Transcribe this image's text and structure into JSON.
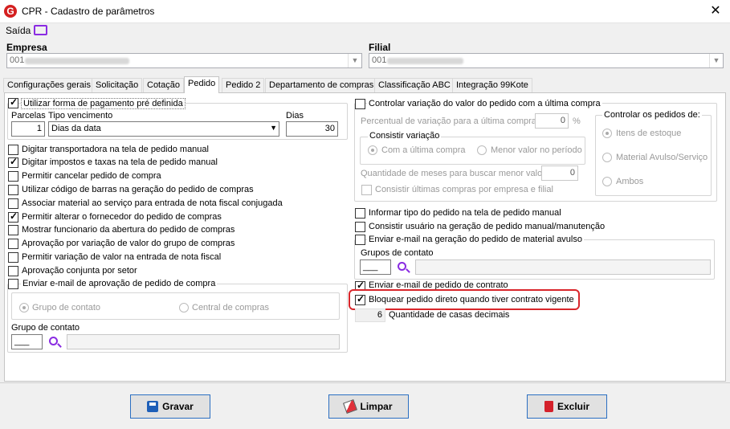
{
  "window": {
    "title": "CPR - Cadastro de parâmetros",
    "close_glyph": "✕",
    "app_icon_letter": "G"
  },
  "menu": {
    "saida": "Saída"
  },
  "empresa": {
    "label": "Empresa",
    "value": "001"
  },
  "filial": {
    "label": "Filial",
    "value": "001"
  },
  "tabs": [
    {
      "label": "Configurações gerais"
    },
    {
      "label": "Solicitação"
    },
    {
      "label": "Cotação"
    },
    {
      "label": "Pedido"
    },
    {
      "label": "Pedido 2"
    },
    {
      "label": "Departamento de compras"
    },
    {
      "label": "Classificação ABC"
    },
    {
      "label": "Integração 99Kote"
    }
  ],
  "left": {
    "forma_pagamento": {
      "label": "Utilizar forma de pagamento pré definida",
      "checked": true
    },
    "parcelas_label": "Parcelas",
    "parcelas_value": "1",
    "tipo_venc_label": "Tipo vencimento",
    "tipo_venc_value": "Dias da data",
    "dias_label": "Dias",
    "dias_value": "30",
    "options": [
      {
        "label": "Digitar transportadora na tela de pedido manual",
        "checked": false
      },
      {
        "label": "Digitar impostos e taxas na tela de pedido manual",
        "checked": true
      },
      {
        "label": "Permitir cancelar pedido de compra",
        "checked": false
      },
      {
        "label": "Utilizar código de barras na geração do pedido de compras",
        "checked": false
      },
      {
        "label": "Associar material ao serviço para entrada de nota fiscal conjugada",
        "checked": false
      },
      {
        "label": "Permitir alterar o fornecedor do pedido de compras",
        "checked": true
      },
      {
        "label": "Mostrar funcionario da abertura do pedido de compras",
        "checked": false
      },
      {
        "label": "Aprovação por variação de valor do grupo de compras",
        "checked": false
      },
      {
        "label": "Permitir variação de valor na entrada de nota fiscal",
        "checked": false
      },
      {
        "label": "Aprovação conjunta por setor",
        "checked": false
      },
      {
        "label": "Enviar e-mail de aprovação de pedido de compra",
        "checked": false
      }
    ],
    "radio_grupo": "Grupo de contato",
    "radio_central": "Central de compras",
    "grupo_contato_label": "Grupo de contato",
    "grupo_contato_value": "___"
  },
  "right": {
    "controlar_variacao": {
      "label": "Controlar variação do valor do pedido com a última compra",
      "checked": false
    },
    "percentual_label": "Percentual de variação para a última compra",
    "percentual_value": "0",
    "percent_sign": "%",
    "consistir_variacao_title": "Consistir variação",
    "radio_ultima": "Com a última compra",
    "radio_menor": "Menor valor no período",
    "qtd_meses_label": "Quantidade de meses para buscar menor valor",
    "qtd_meses_value": "0",
    "consistir_ultimas": "Consistir últimas compras por empresa e filial",
    "controlar_pedidos_title": "Controlar os pedidos de:",
    "radio_itens": "Itens de estoque",
    "radio_avulso": "Material Avulso/Serviço",
    "radio_ambos": "Ambos",
    "options": [
      {
        "label": "Informar tipo do pedido na tela de pedido manual",
        "checked": false
      },
      {
        "label": "Consistir usuário na geração de pedido manual/manutenção",
        "checked": false
      },
      {
        "label": "Enviar e-mail na geração do pedido de material avulso",
        "checked": false
      }
    ],
    "grupos_contato_label": "Grupos de contato",
    "grupos_contato_value": "___",
    "enviar_contrato": {
      "label": "Enviar e-mail de pedido de contrato",
      "checked": true
    },
    "bloquear": {
      "label": "Bloquear pedido direto quando tiver contrato vigente",
      "checked": true
    },
    "casas_value": "6",
    "casas_label": "Quantidade de casas decimais"
  },
  "buttons": {
    "gravar": "Gravar",
    "limpar": "Limpar",
    "excluir": "Excluir"
  },
  "colors": {
    "accent": "#2b6fc2",
    "highlight": "#d9262b",
    "icon_purple": "#8a2be2"
  }
}
